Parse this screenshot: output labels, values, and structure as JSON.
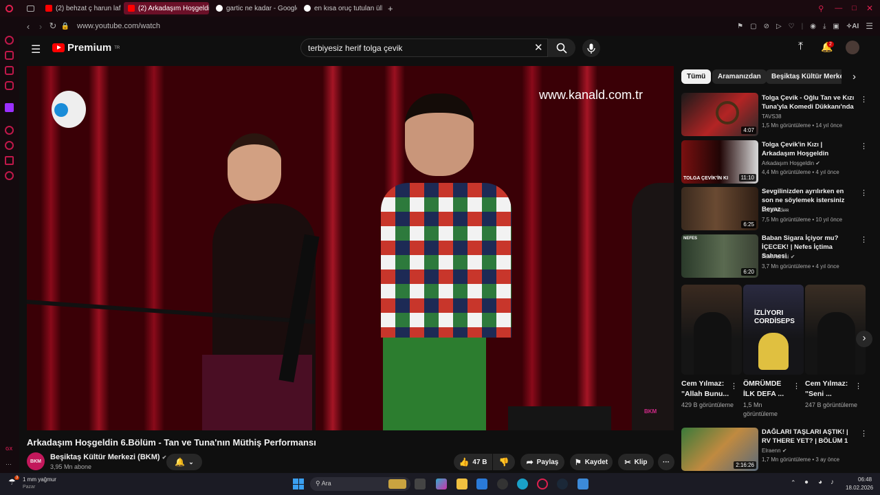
{
  "browser": {
    "tabs": [
      {
        "label": "(2) behzat ç harun laf sokm",
        "active": false
      },
      {
        "label": "(2) Arkadaşım Hoşgeldin 6",
        "active": true
      },
      {
        "label": "gartic ne kadar - Google'da",
        "active": false
      },
      {
        "label": "en kısa oruç tutulan ülke -",
        "active": false
      }
    ],
    "new_tab": "+",
    "url": "www.youtube.com/watch",
    "ai_label": "AI"
  },
  "youtube": {
    "logo": "Premium",
    "logo_region": "TR",
    "search_query": "terbiyesiz herif tolga çevik",
    "notification_count": "2"
  },
  "video": {
    "watermark": "www.kanald.com.tr",
    "title": "Arkadaşım Hoşgeldin 6.Bölüm - Tan ve Tuna'nın Müthiş Performansı",
    "channel": "Beşiktaş Kültür Merkezi (BKM)",
    "channel_avatar": "BKM",
    "subscribers": "3,95 Mn abone",
    "likes": "47 B",
    "share": "Paylaş",
    "save": "Kaydet",
    "clip": "Klip"
  },
  "chips": [
    "Tümü",
    "Aramanızdan",
    "Beşiktaş Kültür Merkezi"
  ],
  "related": [
    {
      "title": "Tolga Çevik - Oğlu Tan ve Kızı Tuna'yla Komedi Dükkanı'nda",
      "channel": "TAVS38",
      "meta": "1,5 Mn görüntüleme • 14 yıl önce",
      "duration": "4:07",
      "verified": false
    },
    {
      "title": "Tolga Çevik'in Kızı | Arkadaşım Hoşgeldin",
      "channel": "Arkadaşım Hoşgeldin",
      "meta": "4,4 Mn görüntüleme • 4 yıl önce",
      "duration": "11:10",
      "verified": true
    },
    {
      "title": "Sevgilinizden ayrılırken en son ne söylemek istersiniz Beyaz ...",
      "channel": "sezer adım",
      "meta": "7,5 Mn görüntüleme • 10 yıl önce",
      "duration": "6:25",
      "verified": false
    },
    {
      "title": "Baban Sigara İçiyor mu? İÇECEK! | Nefes İçtima Sahnesi",
      "channel": "Film Adresi",
      "meta": "3,7 Mn görüntüleme • 4 yıl önce",
      "duration": "6:20",
      "verified": true
    }
  ],
  "thumb_text": {
    "t2": "TOLGA ÇEVİK'İN KI",
    "t4": "NEFES"
  },
  "shorts": [
    {
      "title": "Cem Yılmaz: \"Allah Bunu...",
      "views": "429 B görüntüleme"
    },
    {
      "title": "ÖMRÜMDE İLK DEFA ...",
      "views": "1,5 Mn görüntüleme"
    },
    {
      "title": "Cem Yılmaz: \"Seni ...",
      "views": "247 B görüntüleme"
    }
  ],
  "shorts_overlay": "İZLİYORI CORDİSEPS",
  "related_bottom": {
    "title": "DAĞLARI TAŞLARI AŞTIK! | RV THERE YET? | BÖLÜM 1",
    "channel": "Elraenn",
    "meta": "1,7 Mn görüntüleme • 3 ay önce",
    "duration": "2:16:26"
  },
  "taskbar": {
    "weather": "1 mm yağmur",
    "weather_sub": "Pazar",
    "weather_badge": "3",
    "search": "Ara",
    "time": "06:48",
    "date": "18.02.2026"
  },
  "colors": {
    "accent": "#c0184a",
    "yt_red": "#ff0000",
    "bg": "#0f0f0f"
  }
}
